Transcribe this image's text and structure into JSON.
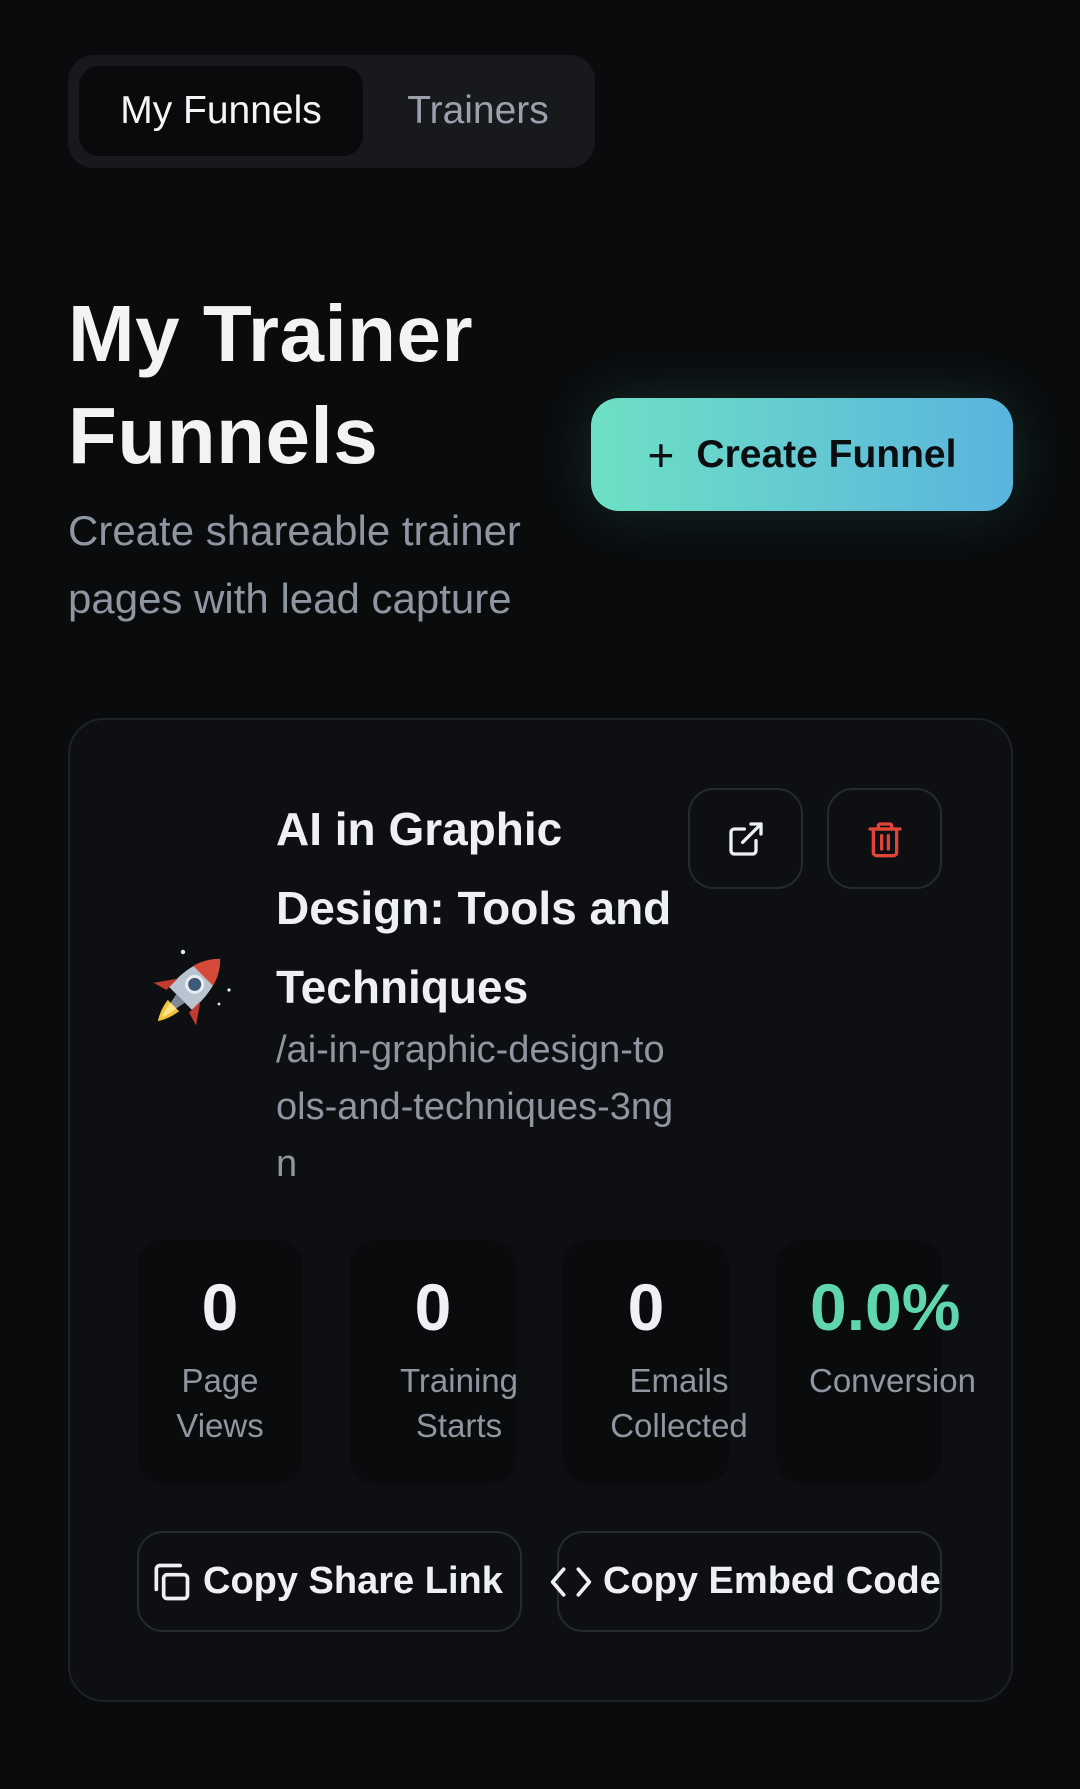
{
  "tabs": [
    {
      "label": "My Funnels",
      "active": true
    },
    {
      "label": "Trainers",
      "active": false
    }
  ],
  "header": {
    "title": "My Trainer Funnels",
    "subtitle": "Create shareable trainer pages with lead capture",
    "create_button_label": "Create Funnel"
  },
  "funnel": {
    "icon": "rocket-emoji",
    "title": "AI in Graphic Design: Tools and Techniques",
    "slug": "/ai-in-graphic-design-tools-and-techniques-3ngn",
    "stats": [
      {
        "value": "0",
        "label": "Page Views"
      },
      {
        "value": "0",
        "label": "Training Starts"
      },
      {
        "value": "0",
        "label": "Emails Collected"
      },
      {
        "value": "0.0%",
        "label": "Conversion"
      }
    ],
    "copy_share_label": "Copy Share Link",
    "copy_embed_label": "Copy Embed Code"
  },
  "colors": {
    "background": "#0a0b0d",
    "accent_gradient_start": "#6ee0c4",
    "accent_gradient_end": "#5ab4de",
    "conversion": "#5fd6b0",
    "delete": "#e0453a"
  },
  "icons": {
    "open": "external-link-icon",
    "delete": "trash-icon",
    "share": "copy-icon",
    "embed": "code-icon",
    "create": "plus-icon"
  }
}
